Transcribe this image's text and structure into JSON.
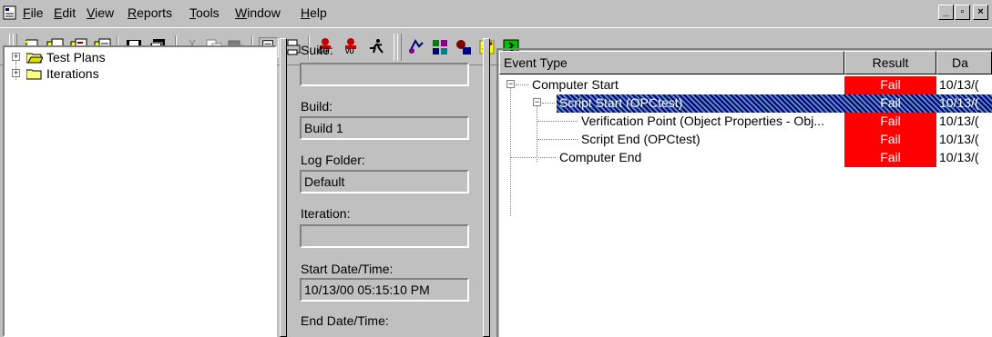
{
  "menubar": {
    "items": [
      {
        "label": "File",
        "u": "F",
        "rest": "ile"
      },
      {
        "label": "Edit",
        "u": "E",
        "rest": "dit"
      },
      {
        "label": "View",
        "u": "V",
        "rest": "iew"
      },
      {
        "label": "Reports",
        "u": "R",
        "rest": "eports"
      },
      {
        "label": "Tools",
        "u": "T",
        "rest": "ools"
      },
      {
        "label": "Window",
        "u": "W",
        "rest": "indow"
      },
      {
        "label": "Help",
        "u": "H",
        "rest": "elp"
      }
    ],
    "window_buttons": [
      "_",
      "▫",
      "×"
    ]
  },
  "toolbar": {
    "icons": [
      "new-icon",
      "open-icon",
      "open-build-icon",
      "open-log-icon",
      "save-icon",
      "save-all-icon",
      "cut-icon",
      "copy-icon",
      "paste-icon",
      "properties-icon",
      "print-icon",
      "record-gui-icon",
      "record-vu-icon",
      "run-icon",
      "test-manager-icon",
      "datapool-icon",
      "suite-icon",
      "script-icon",
      "log-viewer-icon"
    ],
    "gui_label": "GUI",
    "vu_label": "VU"
  },
  "tree": {
    "items": [
      {
        "label": "Test Plans",
        "expander": "+"
      },
      {
        "label": "Iterations",
        "expander": "+"
      }
    ]
  },
  "details": {
    "suite_label": "Suite:",
    "suite_value": "",
    "build_label": "Build:",
    "build_value": "Build 1",
    "log_folder_label": "Log Folder:",
    "log_folder_value": "Default",
    "iteration_label": "Iteration:",
    "iteration_value": "",
    "start_label": "Start Date/Time:",
    "start_value": "10/13/00 05:15:10 PM",
    "end_label": "End Date/Time:"
  },
  "log": {
    "columns": [
      "Event Type",
      "Result",
      "Da"
    ],
    "rows": [
      {
        "event": "Computer Start",
        "result": "Fail",
        "date": "10/13/(",
        "expander": "−"
      },
      {
        "event": "Script Start (OPCtest)",
        "result": "Fail",
        "date": "10/13/(",
        "expander": "−"
      },
      {
        "event": "Verification Point (Object Properties - Obj...",
        "result": "Fail",
        "date": "10/13/("
      },
      {
        "event": "Script End (OPCtest)",
        "result": "Fail",
        "date": "10/13/("
      },
      {
        "event": "Computer End",
        "result": "Fail",
        "date": "10/13/("
      }
    ]
  },
  "colors": {
    "fail": "#ff0000",
    "selection": "#000080",
    "face": "#c0c0c0"
  }
}
